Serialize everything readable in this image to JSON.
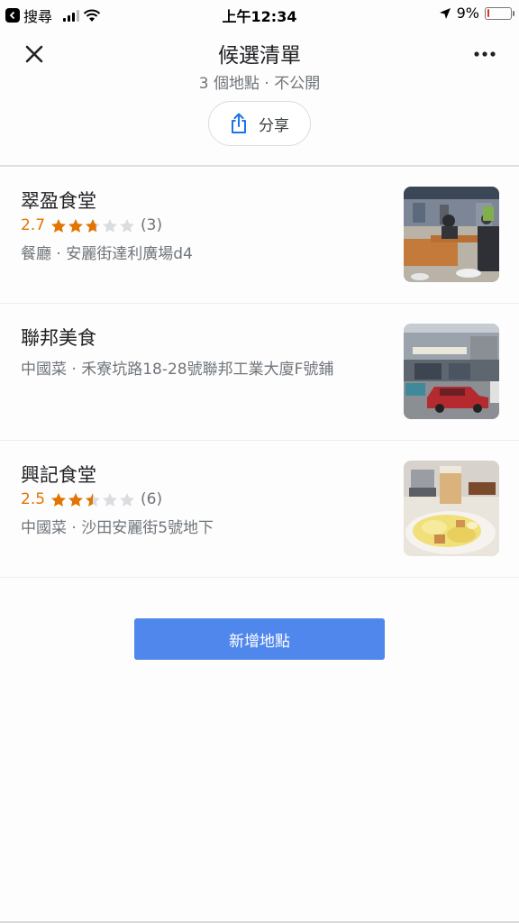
{
  "statusbar": {
    "back_app": "搜尋",
    "time": "上午12:34",
    "battery": "9%",
    "battery_level": 0.09
  },
  "header": {
    "title": "候選清單",
    "subtitle": "3 個地點 · 不公開",
    "share_label": "分享"
  },
  "places": [
    {
      "name": "翠盈食堂",
      "rating": "2.7",
      "rating_value": 2.7,
      "reviews": "(3)",
      "meta": "餐廳 · 安麗街達利廣場d4",
      "photo": "food-court-interior"
    },
    {
      "name": "聯邦美食",
      "meta": "中國菜 · 禾寮坑路18-28號聯邦工業大廈F號鋪",
      "photo": "street-view-red-car"
    },
    {
      "name": "興記食堂",
      "rating": "2.5",
      "rating_value": 2.5,
      "reviews": "(6)",
      "meta": "中國菜 · 沙田安麗街5號地下",
      "photo": "dish-with-milk-tea"
    }
  ],
  "add_place_label": "新增地點",
  "colors": {
    "accent": "#5087ec",
    "rating": "#e37400",
    "star_filled": "#e37400",
    "star_empty": "#dadce0"
  }
}
